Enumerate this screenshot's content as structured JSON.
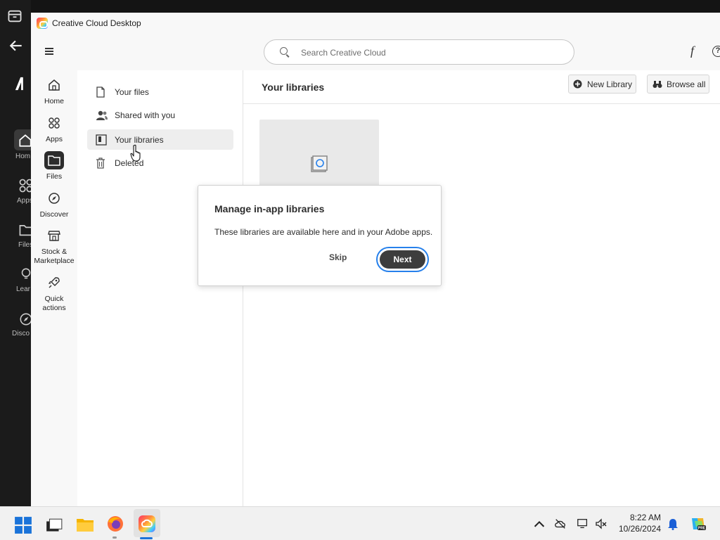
{
  "background_window": {
    "sidebar_labels": [
      "Hom",
      "Apps",
      "Files",
      "Lear",
      "Disco"
    ]
  },
  "window": {
    "title": "Creative Cloud Desktop"
  },
  "topbar": {
    "search_placeholder": "Search Creative Cloud",
    "help_glyph": "?",
    "fonts_glyph": "f"
  },
  "rail": {
    "items": [
      {
        "label": "Home",
        "icon": "home-icon"
      },
      {
        "label": "Apps",
        "icon": "apps-icon"
      },
      {
        "label": "Files",
        "icon": "folder-icon",
        "active": true
      },
      {
        "label": "Discover",
        "icon": "compass-icon"
      },
      {
        "label": "Stock &\nMarketplace",
        "icon": "store-icon"
      },
      {
        "label": "Quick\nactions",
        "icon": "rocket-icon"
      }
    ]
  },
  "subnav": {
    "items": [
      {
        "label": "Your files",
        "icon": "file-icon"
      },
      {
        "label": "Shared with you",
        "icon": "shared-users-icon"
      },
      {
        "label": "Your libraries",
        "icon": "library-icon",
        "selected": true
      },
      {
        "label": "Deleted",
        "icon": "trash-icon"
      }
    ]
  },
  "content": {
    "title": "Your libraries",
    "new_library_label": "New Library",
    "browse_all_label": "Browse all"
  },
  "dialog": {
    "title": "Manage in-app libraries",
    "body": "These libraries are available here and in your Adobe apps.",
    "skip_label": "Skip",
    "next_label": "Next"
  },
  "taskbar": {
    "time": "8:22 AM",
    "date": "10/26/2024"
  },
  "colors": {
    "accent_focus": "#2680eb",
    "primary_button": "#3d3d3d",
    "notification_bell": "#1a5fd6"
  }
}
